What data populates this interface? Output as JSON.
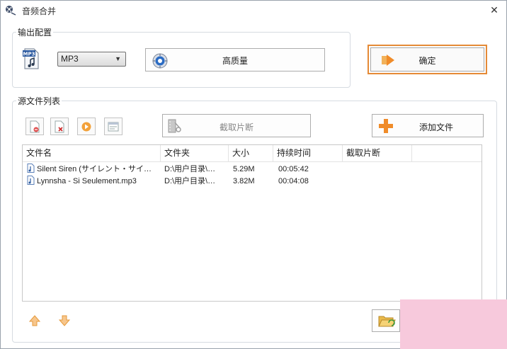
{
  "window": {
    "title": "音频合并",
    "close_glyph": "✕"
  },
  "output_settings": {
    "legend": "输出配置",
    "format_icon": "mp3-file-icon",
    "format_value": "MP3",
    "quality_label": "高质量",
    "confirm_label": "确定"
  },
  "source_files": {
    "legend": "源文件列表",
    "toolbar": {
      "clip_label": "截取片断",
      "add_label": "添加文件",
      "small_icons": [
        "remove-file-icon",
        "delete-file-icon",
        "play-icon",
        "properties-icon"
      ]
    },
    "columns": [
      "文件名",
      "文件夹",
      "大小",
      "持续时间",
      "截取片断"
    ],
    "rows": [
      {
        "name": "Silent Siren (サイレント・サイ…",
        "folder": "D:\\用户目录\\…",
        "size": "5.29M",
        "duration": "00:05:42",
        "clip": ""
      },
      {
        "name": "Lynnsha - Si Seulement.mp3",
        "folder": "D:\\用户目录\\…",
        "size": "3.82M",
        "duration": "00:04:08",
        "clip": ""
      }
    ]
  },
  "colors": {
    "accent_border": "#e58a36",
    "overlay": "#f7c9dc"
  }
}
